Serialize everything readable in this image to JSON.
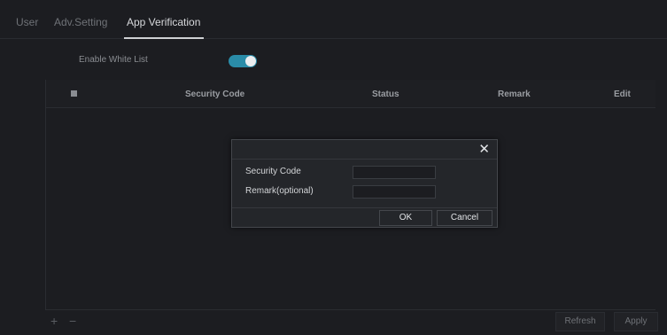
{
  "tabs": [
    {
      "label": "User"
    },
    {
      "label": "Adv.Setting"
    },
    {
      "label": "App Verification"
    }
  ],
  "whitelist": {
    "label": "Enable White List",
    "enabled": true,
    "accent": "#2a8ca8"
  },
  "table": {
    "columns": [
      "Security Code",
      "Status",
      "Remark",
      "Edit"
    ],
    "rows": []
  },
  "footer": {
    "add_icon": "+",
    "remove_icon": "−",
    "refresh_label": "Refresh",
    "apply_label": "Apply"
  },
  "dialog": {
    "close_icon": "✕",
    "fields": [
      {
        "label": "Security Code",
        "value": ""
      },
      {
        "label": "Remark(optional)",
        "value": ""
      }
    ],
    "ok_label": "OK",
    "cancel_label": "Cancel"
  }
}
